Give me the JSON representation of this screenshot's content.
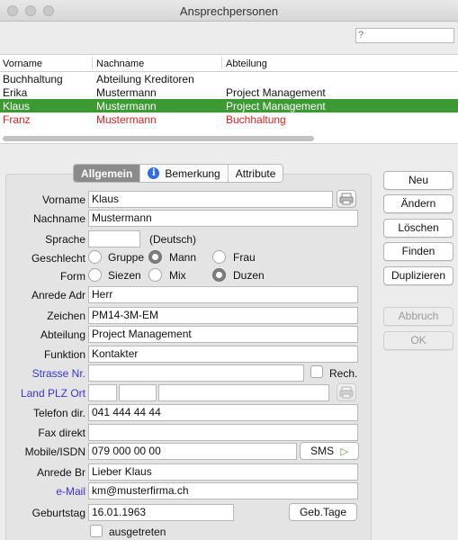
{
  "window": {
    "title": "Ansprechpersonen"
  },
  "search": {
    "value": "?"
  },
  "list": {
    "columns": [
      "Vorname",
      "Nachname",
      "Abteilung"
    ],
    "rows": [
      {
        "vorname": "Buchhaltung",
        "nachname": "Abteilung Kreditoren",
        "abteilung": ""
      },
      {
        "vorname": "Erika",
        "nachname": "Mustermann",
        "abteilung": "Project Management"
      },
      {
        "vorname": "Klaus",
        "nachname": "Mustermann",
        "abteilung": "Project Management"
      },
      {
        "vorname": "Franz",
        "nachname": "Mustermann",
        "abteilung": "Buchhaltung"
      }
    ]
  },
  "tabs": {
    "allgemein": "Allgemein",
    "bemerkung": "Bemerkung",
    "attribute": "Attribute"
  },
  "form": {
    "vorname_label": "Vorname",
    "vorname": "Klaus",
    "nachname_label": "Nachname",
    "nachname": "Mustermann",
    "sprache_label": "Sprache",
    "sprache": "",
    "sprache_hint": "(Deutsch)",
    "geschlecht_label": "Geschlecht",
    "gruppe": "Gruppe",
    "mann": "Mann",
    "frau": "Frau",
    "form_label": "Form",
    "siezen": "Siezen",
    "mix": "Mix",
    "duzen": "Duzen",
    "anrede_adr_label": "Anrede Adr",
    "anrede_adr": "Herr",
    "zeichen_label": "Zeichen",
    "zeichen": "PM14-3M-EM",
    "abteilung_label": "Abteilung",
    "abteilung": "Project Management",
    "funktion_label": "Funktion",
    "funktion": "Kontakter",
    "strasse_label": "Strasse Nr.",
    "strasse": "",
    "rech_label": "Rech.",
    "land_label": "Land PLZ Ort",
    "telefon_label": "Telefon dir.",
    "telefon": "041 444 44 44",
    "fax_label": "Fax direkt",
    "fax": "",
    "mobile_label": "Mobile/ISDN",
    "mobile": "079 000 00 00",
    "sms_label": "SMS",
    "anrede_br_label": "Anrede Br",
    "anrede_br": "Lieber Klaus",
    "email_label": "e-Mail",
    "email": "km@musterfirma.ch",
    "geburtstag_label": "Geburtstag",
    "geburtstag": "16.01.1963",
    "gebtage_label": "Geb.Tage",
    "ausgetreten_label": "ausgetreten"
  },
  "buttons": {
    "neu": "Neu",
    "aendern": "Ändern",
    "loeschen": "Löschen",
    "finden": "Finden",
    "duplizieren": "Duplizieren",
    "abbruch": "Abbruch",
    "ok": "OK"
  },
  "colors": {
    "selection": "#3b9a32",
    "highlight_red": "#e02020",
    "link_blue": "#3a34d6",
    "info_blue": "#2f6fe0"
  }
}
